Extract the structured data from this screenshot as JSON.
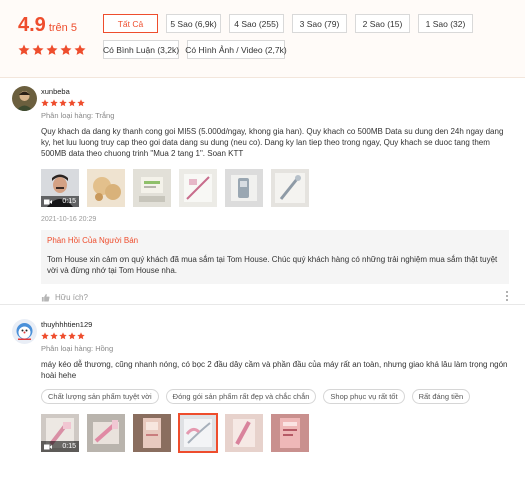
{
  "summary": {
    "score": "4.9",
    "out_of": "trên 5",
    "filters_row1": [
      "Tất Cả",
      "5 Sao (6,9k)",
      "4 Sao (255)",
      "3 Sao (79)",
      "2 Sao (15)",
      "1 Sao (32)"
    ],
    "filters_row2": [
      "Có Bình Luận (3,2k)",
      "Có Hình Ảnh / Video (2,7k)"
    ],
    "active_filter": "Tất Cả",
    "rating_stars": 5
  },
  "colors": {
    "accent": "#ee4d2d",
    "star": "#ee4d2d"
  },
  "reviews": [
    {
      "username": "xunbeba",
      "stars": 5,
      "variation": "Phân loại hàng: Trắng",
      "content": "Quy khach da dang ky thanh cong goi MI5S (5.000d/ngay, khong gia han). Quy khach co 500MB Data su dung den 24h ngay dang ky, het luu luong truy cap theo goi data dang su dung (neu co). Dang ky lan tiep theo trong ngay, Quy khach se duoc tang them 500MB data theo chuong trinh \"Mua 2 tang 1\". Soan KTT",
      "video_duration": "0:15",
      "timestamp": "2021-10-16 20:29",
      "shop_reply_title": "Phản Hồi Của Người Bán",
      "shop_reply_text": "Tom House xin cảm ơn quý khách đã mua sắm tại Tom House. Chúc quý khách hàng có những trải nghiệm mua sắm thật tuyệt vời và đừng nhớ tại Tom House nha.",
      "helpful_label": "Hữu ích?"
    },
    {
      "username": "thuyhhhtien129",
      "stars": 5,
      "variation": "Phân loại hàng: Hồng",
      "content": "máy kéo dễ thương, cũng nhanh nóng, có bọc 2 đầu dây cầm và phần đầu của máy rất an toàn, nhưng giao khá lâu làm trọng ngón hoài hehe",
      "tags": [
        "Chất lượng sản phẩm tuyệt vời",
        "Đóng gói sản phẩm rất đẹp và chắc chắn",
        "Shop phục vụ rất tốt",
        "Rất đáng tiền"
      ],
      "video_duration": "0:15"
    }
  ]
}
